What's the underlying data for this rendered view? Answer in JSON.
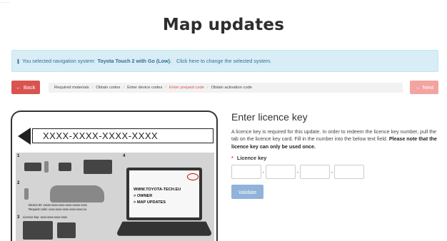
{
  "page": {
    "title": "Map updates"
  },
  "info": {
    "icon": "info-icon",
    "prefix": "You selected navigation system:",
    "system": "Toyota Touch 2 with Go (Low).",
    "change_link": "Click here to change the selected system."
  },
  "nav": {
    "back_label": "Back",
    "next_label": "Next",
    "steps": [
      {
        "label": "Required materials",
        "active": false
      },
      {
        "label": "Obtain codes",
        "active": false
      },
      {
        "label": "Enter device codes",
        "active": false
      },
      {
        "label": "Enter prepaid code",
        "active": true
      },
      {
        "label": "Obtain activation code",
        "active": false
      }
    ]
  },
  "illustration": {
    "key_placeholder": "XXXX-XXXX-XXXX-XXXX",
    "panel_numbers": [
      "1",
      "2",
      "3",
      "4"
    ],
    "device_id_text": "Device ID: xxxxx-xxxx-xxxx-xxxx-xxxxx-xxxx",
    "request_code_text": "Request code: xxxx-xxxx-xxxx-xxxx-xxxx-xx",
    "licence_key_text": "Licence key: xxxx-xxxx-xxxx-xxxx",
    "site_lines": [
      "WWW.TOYOTA-TECH.EU",
      "> OWNER",
      "> MAP UPDATES"
    ]
  },
  "form": {
    "heading": "Enter licence key",
    "description": "A licence key is required for this update. In order to redeem the licence key number, pull the tab on the licence key card. Fill in the number into the below text field.",
    "description_bold": "Please note that the licence key can only be used once.",
    "required_mark": "*",
    "field_label": "Licence key",
    "key_parts": [
      "",
      "",
      "",
      ""
    ],
    "separator": "-",
    "validate_label": "Validate"
  },
  "colors": {
    "danger": "#d9534f",
    "info_bg": "#d9edf7",
    "primary_disabled": "#8fb3d9"
  }
}
